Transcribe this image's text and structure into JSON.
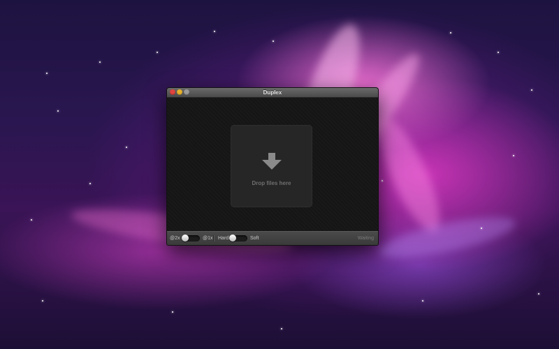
{
  "window": {
    "title": "Duplex"
  },
  "dropzone": {
    "icon": "download-arrow-icon",
    "label": "Drop files here"
  },
  "toolbar": {
    "scale_left_label": "@2x",
    "scale_right_label": "@1x",
    "scale_position": 0,
    "edge_left_label": "Hard",
    "edge_right_label": "Soft",
    "edge_position": 0,
    "status": "Waiting"
  },
  "colors": {
    "close": "#e0443e",
    "minimize": "#e6b12c",
    "zoom": "#9a9a9a",
    "window_background": "#151515",
    "dropzone_background": "#262626"
  }
}
